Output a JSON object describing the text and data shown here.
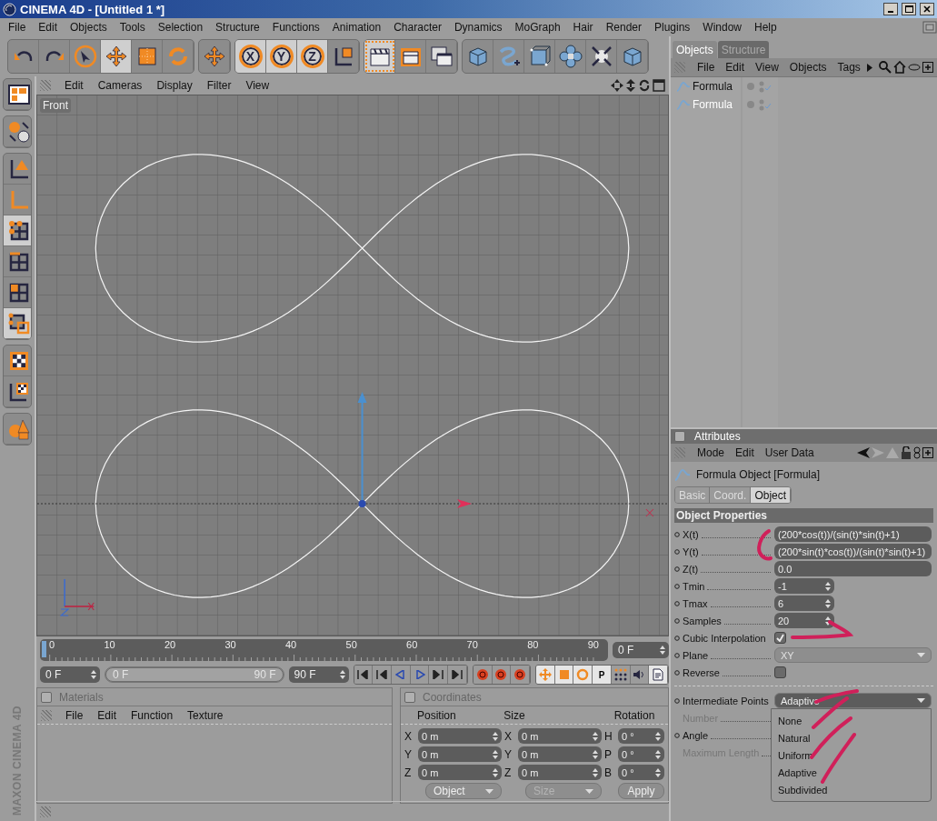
{
  "window": {
    "title": "CINEMA 4D - [Untitled 1 *]"
  },
  "menu": [
    "File",
    "Edit",
    "Objects",
    "Tools",
    "Selection",
    "Structure",
    "Functions",
    "Animation",
    "Character",
    "Dynamics",
    "MoGraph",
    "Hair",
    "Render",
    "Plugins",
    "Window",
    "Help"
  ],
  "toolbar": [
    [
      {
        "kind": "undo",
        "selected": false
      },
      {
        "kind": "redo",
        "selected": false
      },
      {
        "kind": "select",
        "selected": false
      },
      {
        "kind": "move",
        "selected": true
      },
      {
        "kind": "scale",
        "selected": false
      },
      {
        "kind": "rotate",
        "selected": false
      }
    ],
    [
      {
        "kind": "move",
        "selected": false
      }
    ],
    [
      {
        "kind": "letter",
        "label": "X",
        "selected": true
      },
      {
        "kind": "letter",
        "label": "Y",
        "selected": true
      },
      {
        "kind": "letter",
        "label": "Z",
        "selected": true
      },
      {
        "kind": "coord",
        "selected": false
      }
    ],
    [
      {
        "kind": "clapper",
        "selected": true
      },
      {
        "kind": "clapper-region",
        "selected": false
      },
      {
        "kind": "clappers",
        "selected": false
      }
    ],
    [
      {
        "kind": "cube",
        "selected": false
      },
      {
        "kind": "spline",
        "selected": false
      },
      {
        "kind": "nurbs",
        "selected": false
      },
      {
        "kind": "array",
        "selected": false
      },
      {
        "kind": "deformer",
        "selected": false
      },
      {
        "kind": "cube",
        "selected": false
      }
    ]
  ],
  "side_toolbar": [
    [
      {
        "kind": "layout",
        "selected": false
      }
    ],
    [
      {
        "kind": "convert",
        "selected": false
      }
    ],
    [
      {
        "kind": "objaxis",
        "selected": false
      },
      {
        "kind": "axis",
        "selected": false
      },
      {
        "kind": "points",
        "selected": true
      },
      {
        "kind": "edges",
        "selected": false
      },
      {
        "kind": "polygons",
        "selected": false
      },
      {
        "kind": "uv",
        "selected": true
      }
    ],
    [
      {
        "kind": "texture",
        "selected": false
      },
      {
        "kind": "texaxis",
        "selected": false
      }
    ],
    [
      {
        "kind": "primitives",
        "selected": false
      }
    ]
  ],
  "logo": "MAXON CINEMA 4D",
  "viewport": {
    "menu": [
      "Edit",
      "Cameras",
      "Display",
      "Filter",
      "View"
    ],
    "camera": "Front"
  },
  "timeline": {
    "ticks": [
      "0",
      "10",
      "20",
      "30",
      "40",
      "50",
      "60",
      "70",
      "80",
      "90"
    ],
    "level": 0,
    "current": "0 F"
  },
  "playback": {
    "level": 1,
    "start": "0 F",
    "range_start": "0 F",
    "range_end": "90 F",
    "end": "90 F",
    "key_label": "P"
  },
  "materials": {
    "title": "Materials",
    "menu": [
      "File",
      "Edit",
      "Function",
      "Texture"
    ]
  },
  "coordinates": {
    "title": "Coordinates",
    "headers": [
      "Position",
      "Size",
      "Rotation"
    ],
    "rows": [
      {
        "axis": "X",
        "position": "0 m",
        "size_axis": "X",
        "size": "0 m",
        "rotation_axis": "H",
        "rotation": "0 °"
      },
      {
        "axis": "Y",
        "position": "0 m",
        "size_axis": "Y",
        "size": "0 m",
        "rotation_axis": "P",
        "rotation": "0 °"
      },
      {
        "axis": "Z",
        "position": "0 m",
        "size_axis": "Z",
        "size": "0 m",
        "rotation_axis": "B",
        "rotation": "0 °"
      }
    ],
    "mode": "Object",
    "size_mode": "Size",
    "size_mode_disabled": true,
    "apply": "Apply"
  },
  "objects": {
    "tabs": [
      {
        "label": "Objects",
        "selected": true
      },
      {
        "label": "Structure",
        "selected": false
      }
    ],
    "menu": [
      "File",
      "Edit",
      "View",
      "Objects",
      "Tags"
    ],
    "items": [
      {
        "name": "Formula",
        "selected": false
      },
      {
        "name": "Formula",
        "selected": true
      }
    ]
  },
  "attributes": {
    "title": "Attributes",
    "menu": [
      "Mode",
      "Edit",
      "User Data"
    ],
    "object": "Formula Object [Formula]",
    "tabs": [
      {
        "label": "Basic",
        "selected": false
      },
      {
        "label": "Coord.",
        "selected": false
      },
      {
        "label": "Object",
        "selected": true
      }
    ],
    "section": "Object Properties",
    "fields": [
      {
        "kind": "text",
        "label": "X(t)",
        "value": "(200*cos(t))/(sin(t)*sin(t)+1)"
      },
      {
        "kind": "text",
        "label": "Y(t)",
        "value": "(200*sin(t)*cos(t))/(sin(t)*sin(t)+1)"
      },
      {
        "kind": "text",
        "label": "Z(t)",
        "value": "0.0"
      },
      {
        "kind": "spinner",
        "label": "Tmin",
        "value": "-1"
      },
      {
        "kind": "spinner",
        "label": "Tmax",
        "value": "6"
      },
      {
        "kind": "spinner",
        "label": "Samples",
        "value": "20"
      },
      {
        "kind": "checkbox",
        "label": "Cubic Interpolation",
        "checked": true
      },
      {
        "kind": "dropdown",
        "label": "Plane",
        "value": "XY",
        "disabled": true
      },
      {
        "kind": "checkbox",
        "label": "Reverse",
        "checked": false
      }
    ],
    "fields_2": [
      {
        "kind": "dropdown",
        "label": "Intermediate Points",
        "value": "Adaptive",
        "disabled": false,
        "expanded": true,
        "options": [
          "None",
          "Natural",
          "Uniform",
          "Adaptive",
          "Subdivided"
        ]
      },
      {
        "kind": "label",
        "label": "Number",
        "disabled": true
      },
      {
        "kind": "label",
        "label": "Angle",
        "disabled": false
      },
      {
        "kind": "label",
        "label": "Maximum Length",
        "disabled": true
      }
    ]
  }
}
